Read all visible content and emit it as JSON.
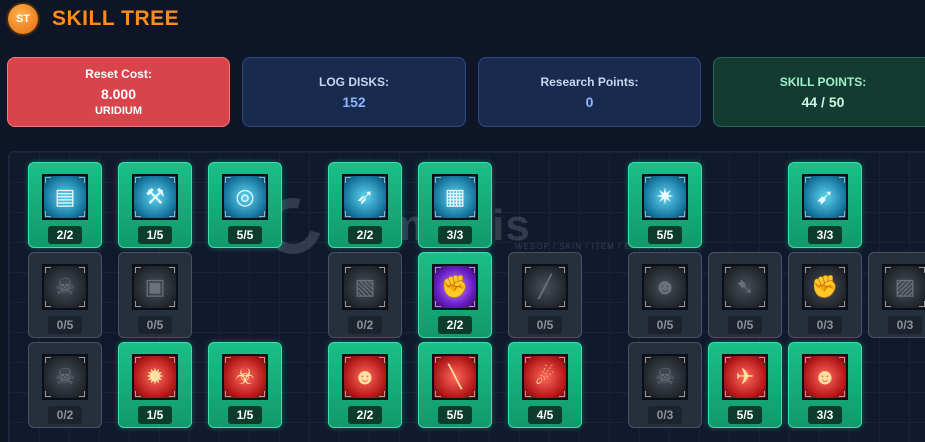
{
  "header": {
    "logo_text": "ST",
    "title": "SKILL TREE"
  },
  "stats": {
    "reset": {
      "label": "Reset Cost:",
      "value": "8.000",
      "unit": "URIDIUM"
    },
    "log_disks": {
      "label": "LOG DISKS:",
      "value": "152"
    },
    "research_points": {
      "label": "Research Points:",
      "value": "0"
    },
    "skill_points": {
      "label": "SKILL POINTS:",
      "value": "44 / 50"
    }
  },
  "colors": {
    "accent_orange": "#ff8c1a",
    "reset_red": "#d9434b",
    "panel_blue": "#182a4d",
    "skill_green": "#143b32",
    "active_node": "#1bbf88",
    "locked_node": "#26303d"
  },
  "watermark": {
    "text": "itemsatis",
    "subtext": "WESOP / SKIN / ITEM / E-PIN .com"
  },
  "skills": [
    {
      "level": "2/2",
      "state": "active",
      "theme": "tech",
      "icon": "shield-plating-icon"
    },
    {
      "level": "1/5",
      "state": "active",
      "theme": "tech",
      "icon": "wrench-repair-icon"
    },
    {
      "level": "5/5",
      "state": "active",
      "theme": "tech",
      "icon": "radar-scope-icon"
    },
    {
      "level": "2/2",
      "state": "active",
      "theme": "tech",
      "icon": "rocket-launcher-icon"
    },
    {
      "level": "3/3",
      "state": "active",
      "theme": "tech",
      "icon": "armor-plating-icon"
    },
    {
      "level": "5/5",
      "state": "active",
      "theme": "tech",
      "icon": "energy-blast-icon"
    },
    {
      "level": "3/3",
      "state": "active",
      "theme": "tech",
      "icon": "missile-upgrade-icon"
    },
    {
      "level": "0/5",
      "state": "locked",
      "theme": "grey",
      "icon": "skull-icon"
    },
    {
      "level": "0/5",
      "state": "locked",
      "theme": "grey",
      "icon": "cannon-icon"
    },
    {
      "level": "0/2",
      "state": "locked",
      "theme": "grey",
      "icon": "cargo-box-icon"
    },
    {
      "level": "2/2",
      "state": "active",
      "theme": "purple",
      "icon": "power-fist-icon"
    },
    {
      "level": "0/5",
      "state": "locked",
      "theme": "grey",
      "icon": "laser-beam-icon"
    },
    {
      "level": "0/5",
      "state": "locked",
      "theme": "grey",
      "icon": "alien-head-icon"
    },
    {
      "level": "0/5",
      "state": "locked",
      "theme": "grey",
      "icon": "rocket-icon"
    },
    {
      "level": "0/3",
      "state": "locked",
      "theme": "grey",
      "icon": "fist-icon"
    },
    {
      "level": "0/3",
      "state": "locked",
      "theme": "grey",
      "icon": "crate-icon"
    },
    {
      "level": "0/2",
      "state": "locked",
      "theme": "grey",
      "icon": "skull-icon"
    },
    {
      "level": "1/5",
      "state": "active",
      "theme": "red",
      "icon": "explosion-icon"
    },
    {
      "level": "1/5",
      "state": "active",
      "theme": "red",
      "icon": "biohazard-icon"
    },
    {
      "level": "2/2",
      "state": "active",
      "theme": "red",
      "icon": "alien-head-icon"
    },
    {
      "level": "5/5",
      "state": "active",
      "theme": "red",
      "icon": "rifle-icon"
    },
    {
      "level": "4/5",
      "state": "active",
      "theme": "red",
      "icon": "laser-strike-icon"
    },
    {
      "level": "0/3",
      "state": "locked",
      "theme": "grey",
      "icon": "skull-icon"
    },
    {
      "level": "5/5",
      "state": "active",
      "theme": "red",
      "icon": "fighter-ship-icon"
    },
    {
      "level": "3/3",
      "state": "active",
      "theme": "red",
      "icon": "alien-head-icon"
    }
  ]
}
